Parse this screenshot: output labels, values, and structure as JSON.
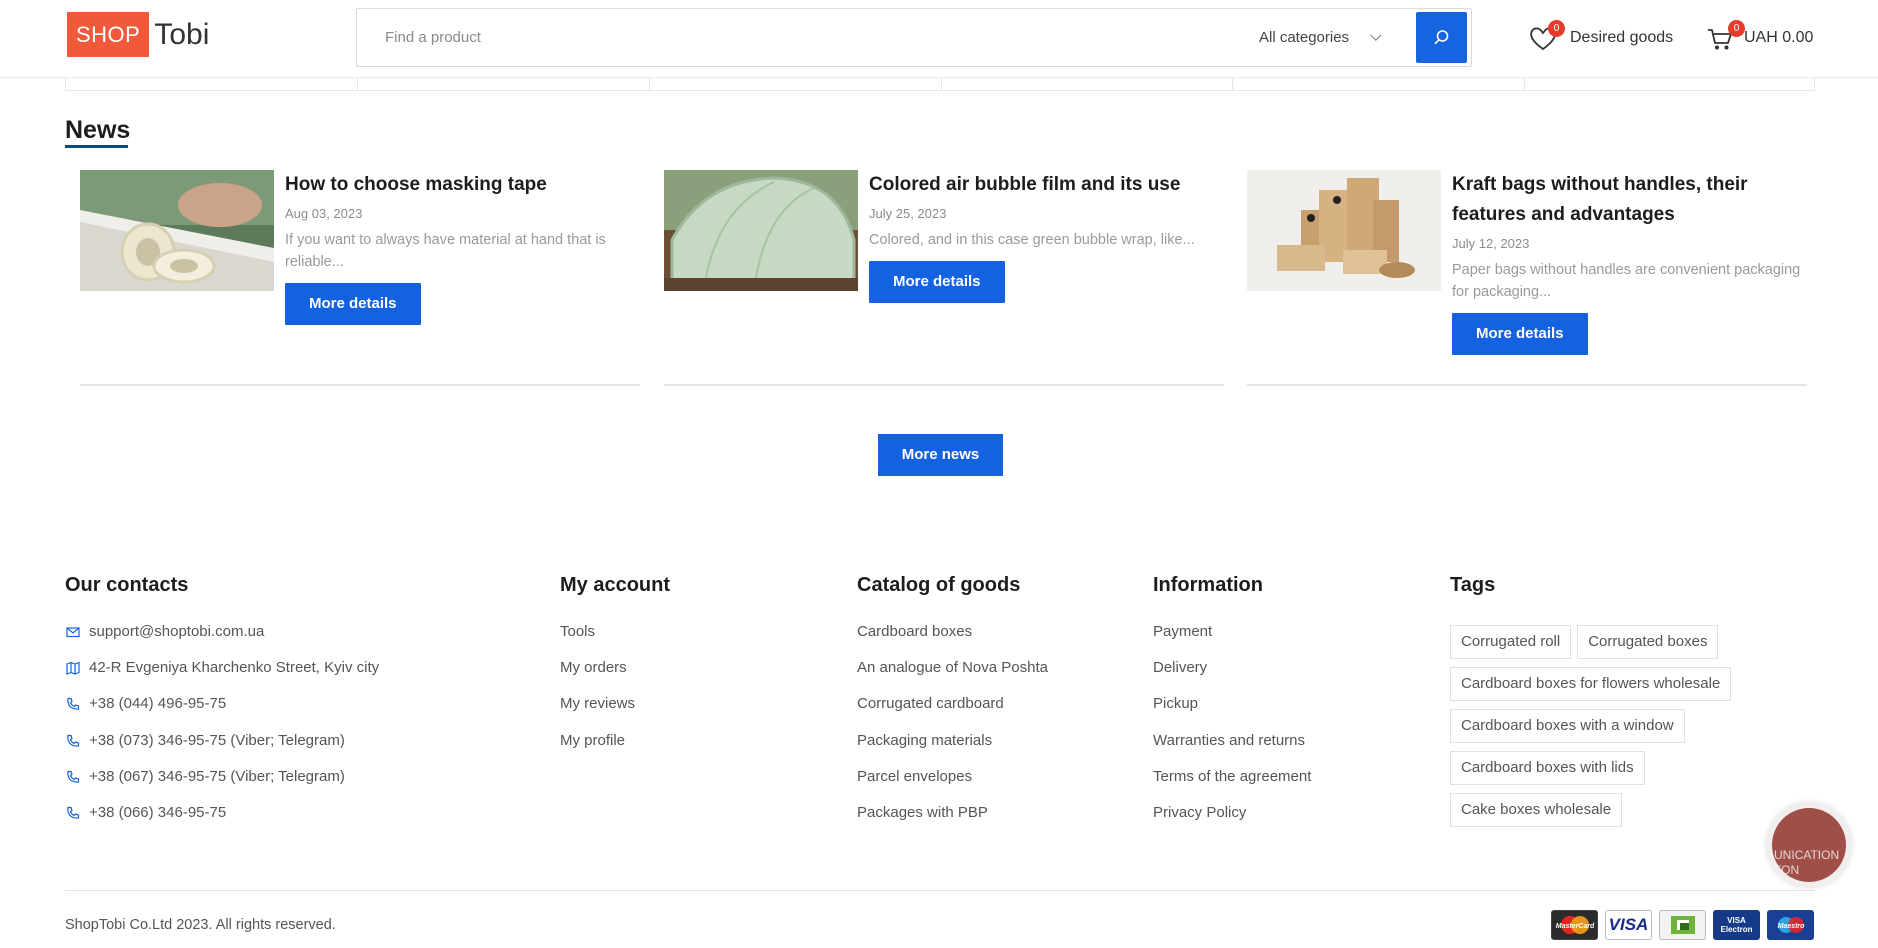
{
  "header": {
    "logo_shop": "SHOP",
    "logo_tobi": "Tobi",
    "search_placeholder": "Find a product",
    "category": "All categories",
    "wishlist_label": "Desired goods",
    "wishlist_count": "0",
    "cart_label": "UAH 0.00",
    "cart_count": "0"
  },
  "news": {
    "title": "News",
    "items": [
      {
        "title": "How to choose masking tape",
        "date": "Aug 03, 2023",
        "excerpt": "If you want to always have material at hand that is reliable...",
        "button": "More details"
      },
      {
        "title": "Colored air bubble film and its use",
        "date": "July 25, 2023",
        "excerpt": "Colored, and in this case green bubble wrap, like...",
        "button": "More details"
      },
      {
        "title": "Kraft bags without handles, their features and advantages",
        "date": "July 12, 2023",
        "excerpt": "Paper bags without handles are convenient packaging for packaging...",
        "button": "More details"
      }
    ],
    "more_button": "More news"
  },
  "footer": {
    "contacts": {
      "title": "Our contacts",
      "items": [
        {
          "icon": "mail-icon",
          "text": "support@shoptobi.com.ua"
        },
        {
          "icon": "map-icon",
          "text": "42-R Evgeniya Kharchenko Street, Kyiv city"
        },
        {
          "icon": "phone-icon",
          "text": "+38 (044) 496-95-75"
        },
        {
          "icon": "phone-icon",
          "text": "+38 (073) 346-95-75 (Viber; Telegram)"
        },
        {
          "icon": "phone-icon",
          "text": "+38 (067) 346-95-75 (Viber; Telegram)"
        },
        {
          "icon": "phone-icon",
          "text": "+38 (066) 346-95-75"
        }
      ]
    },
    "account": {
      "title": "My account",
      "items": [
        "Tools",
        "My orders",
        "My reviews",
        "My profile"
      ]
    },
    "catalog": {
      "title": "Catalog of goods",
      "items": [
        "Cardboard boxes",
        "An analogue of Nova Poshta",
        "Corrugated cardboard",
        "Packaging materials",
        "Parcel envelopes",
        "Packages with PBP"
      ]
    },
    "information": {
      "title": "Information",
      "items": [
        "Payment",
        "Delivery",
        "Pickup",
        "Warranties and returns",
        "Terms of the agreement",
        "Privacy Policy"
      ]
    },
    "tags": {
      "title": "Tags",
      "items": [
        "Corrugated roll",
        "Corrugated boxes",
        "Cardboard boxes for flowers wholesale",
        "Cardboard boxes with a window",
        "Cardboard boxes with lids",
        "Cake boxes wholesale"
      ]
    },
    "copyright": "ShopTobi Co.Ltd 2023. All rights reserved.",
    "payments": [
      {
        "name": "MasterCard",
        "icon": "mastercard-icon"
      },
      {
        "name": "VISA",
        "icon": "visa-icon"
      },
      {
        "name": "",
        "icon": "privat-icon"
      },
      {
        "name": "VISA Electron",
        "icon": "visa-electron-icon"
      },
      {
        "name": "Maestro",
        "icon": "maestro-icon"
      }
    ],
    "communication_widget": "UNICATION TON"
  },
  "colors": {
    "accent": "#1462e0",
    "logo": "#f05a3b",
    "badge": "#e63c2e"
  }
}
